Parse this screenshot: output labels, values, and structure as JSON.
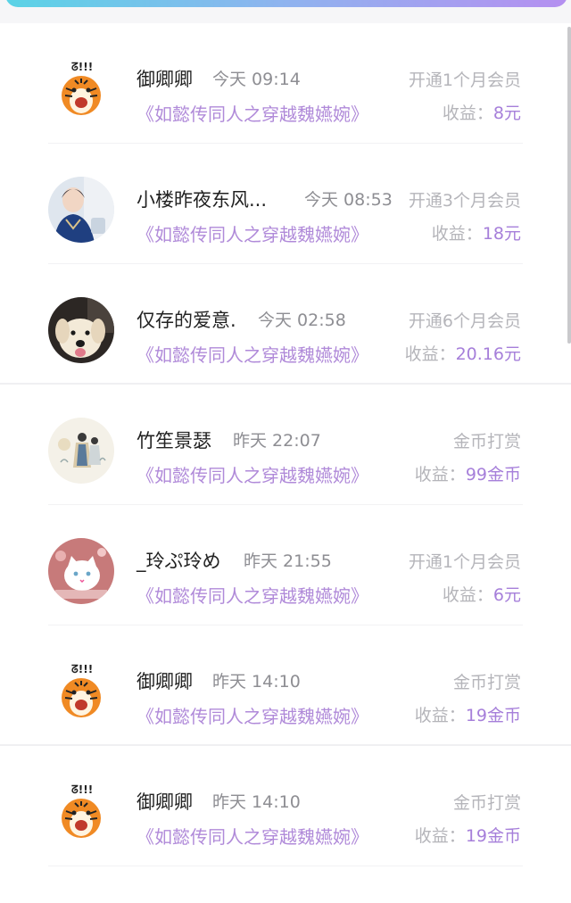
{
  "colors": {
    "accent": "#a67fda",
    "book_title": "#b08ad9",
    "muted": "#b5b5ba"
  },
  "earn_label": "收益：",
  "records": [
    {
      "avatar": "tiger-avatar",
      "name": "御卿卿",
      "time": "今天 09:14",
      "action": "开通1个月会员",
      "book": "《如懿传同人之穿越魏嬿婉》",
      "amount": "8元"
    },
    {
      "avatar": "boy-portrait-avatar",
      "name": "小楼昨夜东风...",
      "time": "今天 08:53",
      "action": "开通3个月会员",
      "book": "《如懿传同人之穿越魏嬿婉》",
      "amount": "18元"
    },
    {
      "avatar": "dog-avatar",
      "name": "仅存的爱意.",
      "time": "今天 02:58",
      "action": "开通6个月会员",
      "book": "《如懿传同人之穿越魏嬿婉》",
      "amount": "20.16元"
    },
    {
      "avatar": "ink-painting-avatar",
      "name": "竹笙景瑟",
      "time": "昨天 22:07",
      "action": "金币打赏",
      "book": "《如懿传同人之穿越魏嬿婉》",
      "amount": "99金币"
    },
    {
      "avatar": "white-cat-avatar",
      "name": "_玲ぷ玲め",
      "time": "昨天 21:55",
      "action": "开通1个月会员",
      "book": "《如懿传同人之穿越魏嬿婉》",
      "amount": "6元"
    },
    {
      "avatar": "tiger-avatar",
      "name": "御卿卿",
      "time": "昨天 14:10",
      "action": "金币打赏",
      "book": "《如懿传同人之穿越魏嬿婉》",
      "amount": "19金币"
    },
    {
      "avatar": "tiger-avatar",
      "name": "御卿卿",
      "time": "昨天 14:10",
      "action": "金币打赏",
      "book": "《如懿传同人之穿越魏嬿婉》",
      "amount": "19金币"
    }
  ]
}
